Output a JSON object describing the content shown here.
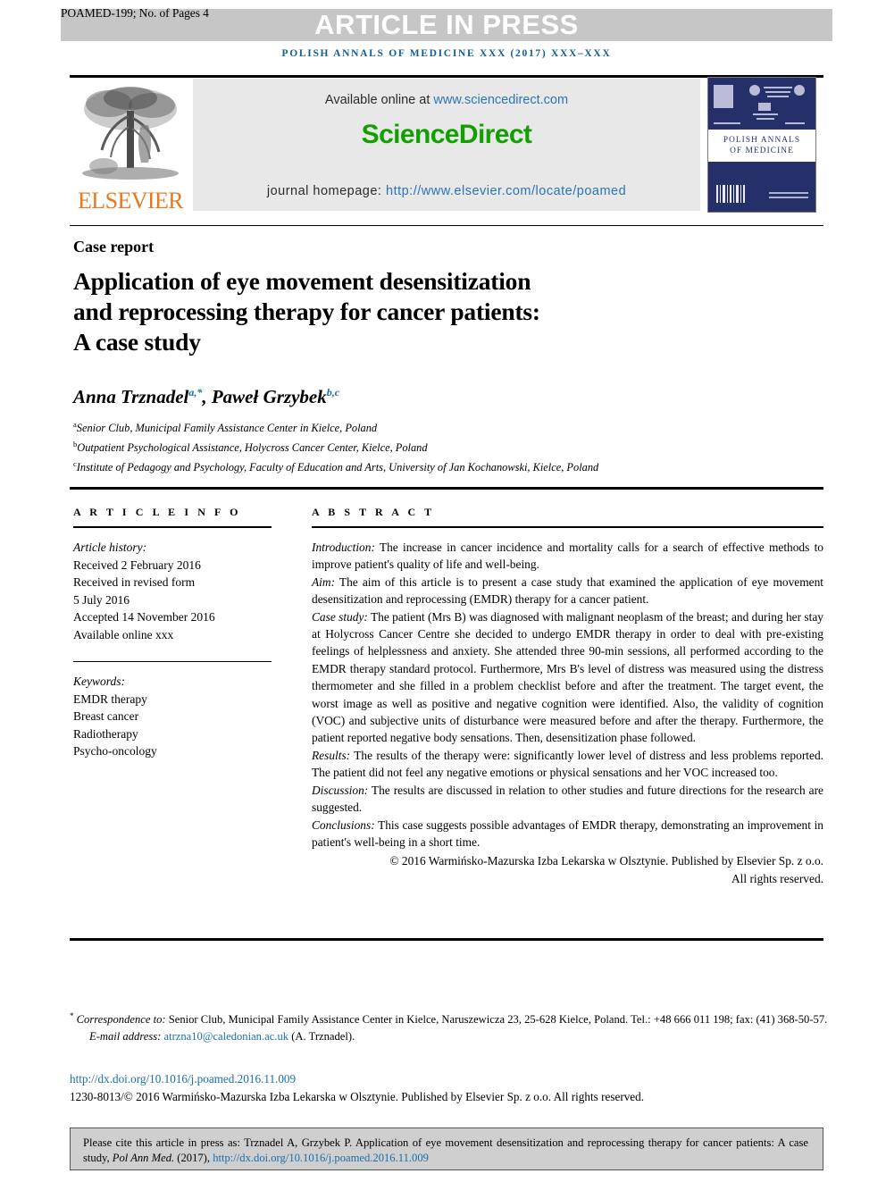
{
  "banner": {
    "runhead": "POAMED-199; No. of Pages 4",
    "title": "ARTICLE IN PRESS",
    "bg_color": "#c6c6c6",
    "text_color": "#ffffff"
  },
  "journal_line": {
    "text": "POLISH ANNALS OF MEDICINE XXX (2017) XXX–XXX",
    "color": "#10608f"
  },
  "masthead": {
    "elsevier_wordmark": "ELSEVIER",
    "elsevier_color": "#e87722",
    "available_prefix": "Available online at ",
    "available_url": "www.sciencedirect.com",
    "sciencedirect_brand": "ScienceDirect",
    "sciencedirect_color": "#11a000",
    "homepage_label": "journal homepage: ",
    "homepage_url": "http://www.elsevier.com/locate/poamed",
    "link_color": "#2d73b5",
    "cover_title_line1": "POLISH ANNALS",
    "cover_title_line2": "OF MEDICINE",
    "cover_bg_color": "#25306b"
  },
  "article": {
    "type": "Case report",
    "title_line1": "Application of eye movement desensitization",
    "title_line2": "and reprocessing therapy for cancer patients:",
    "title_line3": "A case study",
    "authors": [
      {
        "name": "Anna Trznadel",
        "sup": "a,*"
      },
      {
        "name": "Paweł Grzybek",
        "sup": "b,c"
      }
    ],
    "author_sup_color": "#1a6fa8",
    "affiliations": [
      {
        "marker": "a",
        "text": "Senior Club, Municipal Family Assistance Center in Kielce, Poland"
      },
      {
        "marker": "b",
        "text": "Outpatient Psychological Assistance, Holycross Cancer Center, Kielce, Poland"
      },
      {
        "marker": "c",
        "text": "Institute of Pedagogy and Psychology, Faculty of Education and Arts, University of Jan Kochanowski, Kielce, Poland"
      }
    ]
  },
  "info": {
    "heading": "A R T I C L E   I N F O",
    "history_label": "Article history:",
    "history": [
      "Received 2 February 2016",
      "Received in revised form",
      "5 July 2016",
      "Accepted 14 November 2016",
      "Available online xxx"
    ],
    "keywords_label": "Keywords:",
    "keywords": [
      "EMDR therapy",
      "Breast cancer",
      "Radiotherapy",
      "Psycho-oncology"
    ]
  },
  "abstract": {
    "heading": "A B S T R A C T",
    "sections": [
      {
        "label": "Introduction:",
        "text": " The increase in cancer incidence and mortality calls for a search of effective methods to improve patient's quality of life and well-being."
      },
      {
        "label": "Aim:",
        "text": " The aim of this article is to present a case study that examined the application of eye movement desensitization and reprocessing (EMDR) therapy for a cancer patient."
      },
      {
        "label": "Case study:",
        "text": " The patient (Mrs B) was diagnosed with malignant neoplasm of the breast; and during her stay at Holycross Cancer Centre she decided to undergo EMDR therapy in order to deal with pre-existing feelings of helplessness and anxiety. She attended three 90-min sessions, all performed according to the EMDR therapy standard protocol. Furthermore, Mrs B's level of distress was measured using the distress thermometer and she filled in a problem checklist before and after the treatment. The target event, the worst image as well as positive and negative cognition were identified. Also, the validity of cognition (VOC) and subjective units of disturbance were measured before and after the therapy. Furthermore, the patient reported negative body sensations. Then, desensitization phase followed."
      },
      {
        "label": "Results:",
        "text": " The results of the therapy were: significantly lower level of distress and less problems reported. The patient did not feel any negative emotions or physical sensations and her VOC increased too."
      },
      {
        "label": "Discussion:",
        "text": " The results are discussed in relation to other studies and future directions for the research are suggested."
      },
      {
        "label": "Conclusions:",
        "text": " This case suggests possible advantages of EMDR therapy, demonstrating an improvement in patient's well-being in a short time."
      }
    ],
    "copyright_line1": "© 2016 Warmińsko-Mazurska Izba Lekarska w Olsztynie. Published by Elsevier Sp. z o.o.",
    "copyright_line2": "All rights reserved."
  },
  "footer": {
    "correspondence_label": "Correspondence to:",
    "correspondence_text": " Senior Club, Municipal Family Assistance Center in Kielce, Naruszewicza 23, 25-628 Kielce, Poland. Tel.: +48 666 011 198; fax: (41) 368-50-57.",
    "email_label": "E-mail address: ",
    "email": "atrzna10@caledonian.ac.uk",
    "email_attrib": " (A. Trznadel).",
    "doi_url": "http://dx.doi.org/10.1016/j.poamed.2016.11.009",
    "issn_line": "1230-8013/© 2016 Warmińsko-Mazurska Izba Lekarska w Olsztynie. Published by Elsevier Sp. z o.o. All rights reserved.",
    "link_color": "#1a6fa8"
  },
  "cite_box": {
    "text_before": "Please cite this article in press as: Trznadel  A, Grzybek  P. Application of eye movement desensitization and reprocessing therapy for cancer patients: A case study, ",
    "journal_italic": "Pol Ann Med.",
    "text_middle": " (2017), ",
    "link": "http://dx.doi.org/10.1016/j.poamed.2016.11.009",
    "bg_color": "#cfcfcf"
  }
}
